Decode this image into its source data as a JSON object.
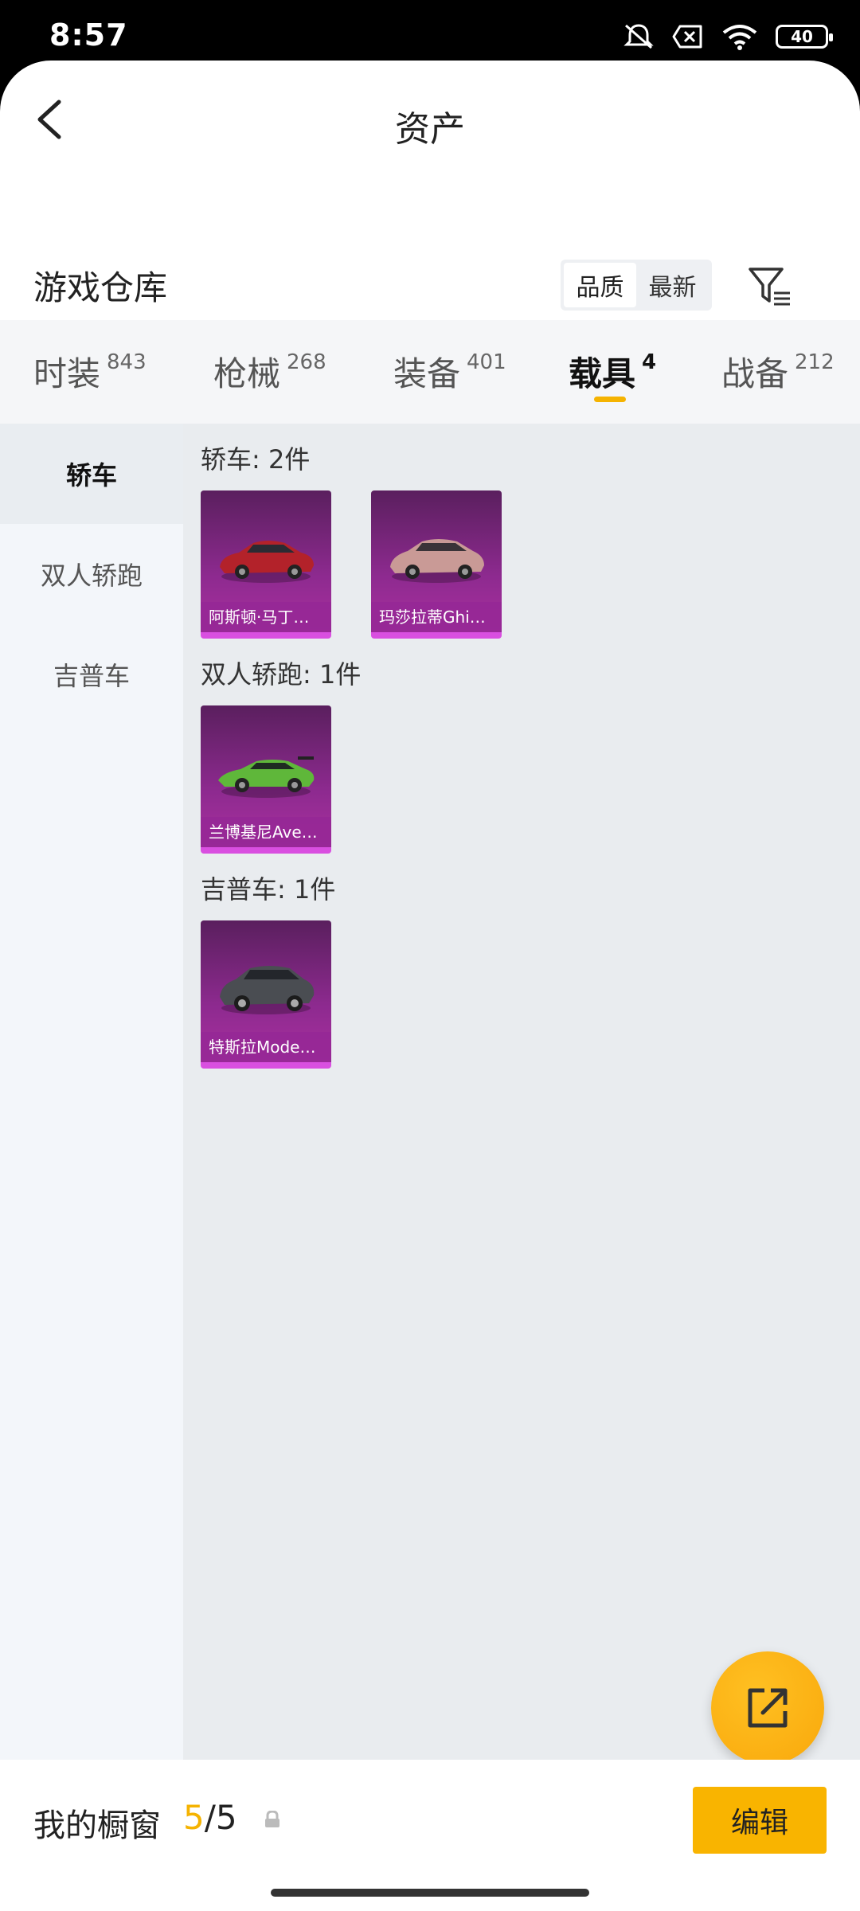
{
  "status_bar": {
    "time": "8:57",
    "battery": "40",
    "icons": [
      "mute-icon",
      "x-icon",
      "wifi-icon",
      "battery-icon"
    ]
  },
  "header": {
    "title": "资产",
    "back_icon": "chevron-left-icon"
  },
  "warehouse": {
    "title": "游戏仓库",
    "sort_options": [
      "品质",
      "最新"
    ],
    "sort_selected": "品质",
    "filter_icon": "filter-icon"
  },
  "tabs": [
    {
      "label": "时装",
      "count": "843"
    },
    {
      "label": "枪械",
      "count": "268"
    },
    {
      "label": "装备",
      "count": "401"
    },
    {
      "label": "载具",
      "count": "4"
    },
    {
      "label": "战备",
      "count": "212"
    }
  ],
  "active_tab": "载具",
  "subnav": [
    {
      "label": "轿车"
    },
    {
      "label": "双人轿跑"
    },
    {
      "label": "吉普车"
    }
  ],
  "active_subnav": "轿车",
  "groups": [
    {
      "title": "轿车: 2件",
      "items": [
        {
          "name": "阿斯顿·马丁…",
          "car_color": "#b3222a"
        },
        {
          "name": "玛莎拉蒂Ghi…",
          "car_color": "#c99a96"
        }
      ]
    },
    {
      "title": "双人轿跑: 1件",
      "items": [
        {
          "name": "兰博基尼Ave…",
          "car_color": "#5fb73a"
        }
      ]
    },
    {
      "title": "吉普车: 1件",
      "items": [
        {
          "name": "特斯拉Mode…",
          "car_color": "#4a4d52"
        }
      ]
    }
  ],
  "fab_icon": "share-external-icon",
  "bottom": {
    "showcase_label": "我的橱窗",
    "showcase_current": "5",
    "showcase_total": "/5",
    "edit_label": "编辑"
  },
  "colors": {
    "accent": "#f9b400",
    "card_purple": "#8d2a8f",
    "card_label": "#962896"
  }
}
